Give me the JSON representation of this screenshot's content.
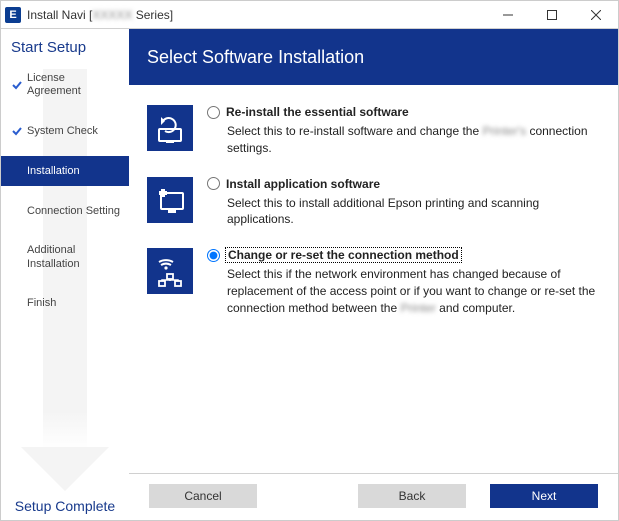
{
  "window": {
    "app_icon_letter": "E",
    "title_prefix": "Install Navi [",
    "title_blurred": "XXXXX",
    "title_suffix": " Series]"
  },
  "sidebar": {
    "header": "Start Setup",
    "footer": "Setup Complete",
    "steps": [
      {
        "label": "License Agreement",
        "done": true,
        "active": false
      },
      {
        "label": "System Check",
        "done": true,
        "active": false
      },
      {
        "label": "Installation",
        "done": false,
        "active": true
      },
      {
        "label": "Connection Setting",
        "done": false,
        "active": false
      },
      {
        "label": "Additional Installation",
        "done": false,
        "active": false
      },
      {
        "label": "Finish",
        "done": false,
        "active": false
      }
    ]
  },
  "content": {
    "header": "Select Software Installation",
    "options": [
      {
        "id": "reinstall",
        "title": "Re-install the essential software",
        "selected": false,
        "desc_before": "Select this to re-install software and change the ",
        "desc_blurred": "Printer's",
        "desc_after": " connection settings."
      },
      {
        "id": "install-app",
        "title": "Install application software",
        "selected": false,
        "desc_before": "Select this to install additional Epson printing and scanning applications.",
        "desc_blurred": "",
        "desc_after": ""
      },
      {
        "id": "change-connection",
        "title": "Change or re-set the connection method",
        "selected": true,
        "desc_before": "Select this if the network environment has changed because of replacement of the access point or if you want to change or re-set the connection method between the ",
        "desc_blurred": "Printer",
        "desc_after": " and computer."
      }
    ]
  },
  "buttons": {
    "cancel": "Cancel",
    "back": "Back",
    "next": "Next"
  }
}
